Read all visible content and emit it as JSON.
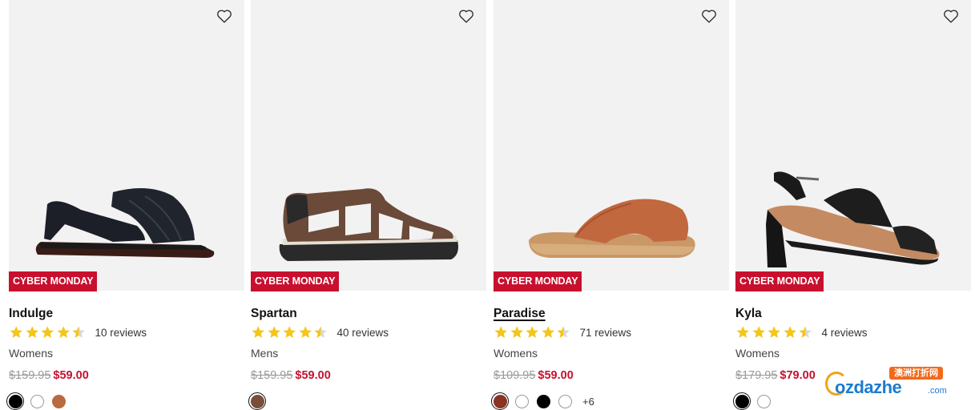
{
  "products": [
    {
      "name": "Indulge",
      "badge": "CYBER MONDAY",
      "rating": 4.5,
      "reviews": "10 reviews",
      "gender": "Womens",
      "was_price": "$159.95",
      "price": "$59.00",
      "swatches": [
        "#000000",
        "#ffffff",
        "#b86a40"
      ],
      "selected_swatch": 0,
      "more": ""
    },
    {
      "name": "Spartan",
      "badge": "CYBER MONDAY",
      "rating": 4.5,
      "reviews": "40 reviews",
      "gender": "Mens",
      "was_price": "$159.95",
      "price": "$59.00",
      "swatches": [
        "#7a4f3a"
      ],
      "selected_swatch": 0,
      "more": ""
    },
    {
      "name": "Paradise",
      "badge": "CYBER MONDAY",
      "rating": 4.5,
      "reviews": "71 reviews",
      "gender": "Womens",
      "was_price": "$109.95",
      "price": "$59.00",
      "swatches": [
        "#8a3320",
        "#ffffff",
        "#000000",
        "#ffffff"
      ],
      "selected_swatch": 0,
      "more": "+6"
    },
    {
      "name": "Kyla",
      "badge": "CYBER MONDAY",
      "rating": 4.5,
      "reviews": "4 reviews",
      "gender": "Womens",
      "was_price": "$179.95",
      "price": "$79.00",
      "swatches": [
        "#000000",
        "#ffffff"
      ],
      "selected_swatch": 0,
      "more": ""
    }
  ],
  "watermark": {
    "tag": "澳洲打折网",
    "logo": "ozdazhe",
    "suffix": ".com"
  },
  "colors": {
    "badge": "#c8102e",
    "sale_price": "#c8102e",
    "star": "#f5c518",
    "image_bg": "#f2f2f2"
  },
  "icons": {
    "wishlist": "heart-outline-icon",
    "rating": "star-icon"
  }
}
